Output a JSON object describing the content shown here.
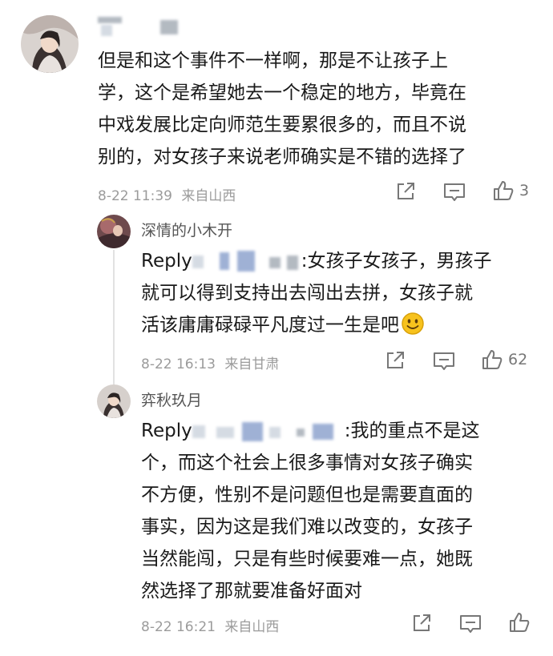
{
  "comments": [
    {
      "author": "",
      "lines": [
        "但是和这个事件不一样啊，那是不让孩子上",
        "学，这个是希望她去一个稳定的地方，毕竟在",
        "中戏发展比定向师范生要累很多的，而且不说",
        "别的，对女孩子来说老师确实是不错的选择了"
      ],
      "time": "8-22 11:39",
      "location": "来自山西",
      "likes": "3"
    }
  ],
  "replies": [
    {
      "author": "深情的小木开",
      "reply_prefix": "Reply",
      "first_line_rest": ":女孩子女孩子，男孩子",
      "lines": [
        "就可以得到支持出去闯出去拼，女孩子就",
        "活该庸庸碌碌平凡度过一生是吧"
      ],
      "time": "8-22 16:13",
      "location": "来自甘肃",
      "likes": "62"
    },
    {
      "author": "弈秋玖月",
      "reply_prefix": "Reply",
      "first_line_rest": ":我的重点不是这",
      "lines": [
        "个，而这个社会上很多事情对女孩子确实",
        "不方便，性别不是问题但也是需要直面的",
        "事实，因为这是我们难以改变的，女孩子",
        "当然能闯，只是有些时候要难一点，她既",
        "然选择了那就要准备好面对"
      ],
      "time": "8-22 16:21",
      "location": "来自山西",
      "likes": ""
    }
  ],
  "icons": {
    "share": "share-icon",
    "comment": "comment-icon",
    "like": "thumbs-up-icon",
    "emoji": "smiley-emoji-icon"
  }
}
